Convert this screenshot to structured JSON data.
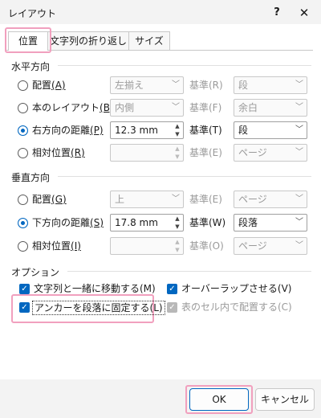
{
  "dialog": {
    "title": "レイアウト",
    "help": "?",
    "close": "✕"
  },
  "tabs": [
    {
      "label": "位置"
    },
    {
      "label": "文字列の折り返し"
    },
    {
      "label": "サイズ"
    }
  ],
  "horizontal": {
    "header": "水平方向",
    "rows": [
      {
        "label": "配置",
        "key": "(A)",
        "value": "左揃え",
        "base_label": "基準(R)",
        "base_value": "段",
        "selected": false,
        "enabled": false
      },
      {
        "label": "本のレイアウト",
        "key": "(B)",
        "value": "内側",
        "base_label": "基準(F)",
        "base_value": "余白",
        "selected": false,
        "enabled": false
      },
      {
        "label": "右方向の距離",
        "key": "(P)",
        "value": "12.3 mm",
        "base_label": "基準(T)",
        "base_value": "段",
        "selected": true,
        "enabled": true
      },
      {
        "label": "相対位置",
        "key": "(R)",
        "value": "",
        "base_label": "基準(E)",
        "base_value": "ページ",
        "selected": false,
        "enabled": false
      }
    ]
  },
  "vertical": {
    "header": "垂直方向",
    "rows": [
      {
        "label": "配置",
        "key": "(G)",
        "value": "上",
        "base_label": "基準(E)",
        "base_value": "ページ",
        "selected": false,
        "enabled": false
      },
      {
        "label": "下方向の距離",
        "key": "(S)",
        "value": "17.8 mm",
        "base_label": "基準(W)",
        "base_value": "段落",
        "selected": true,
        "enabled": true
      },
      {
        "label": "相対位置",
        "key": "(I)",
        "value": "",
        "base_label": "基準(O)",
        "base_value": "ページ",
        "selected": false,
        "enabled": false
      }
    ]
  },
  "options": {
    "header": "オプション",
    "move_with_text": "文字列と一緒に移動する(M)",
    "allow_overlap": "オーバーラップさせる(V)",
    "lock_anchor": "アンカーを段落に固定する(L)",
    "layout_in_cell": "表のセル内で配置する(C)"
  },
  "buttons": {
    "ok": "OK",
    "cancel": "キャンセル"
  },
  "colors": {
    "accent": "#0067c0",
    "highlight": "#f1a0be"
  }
}
